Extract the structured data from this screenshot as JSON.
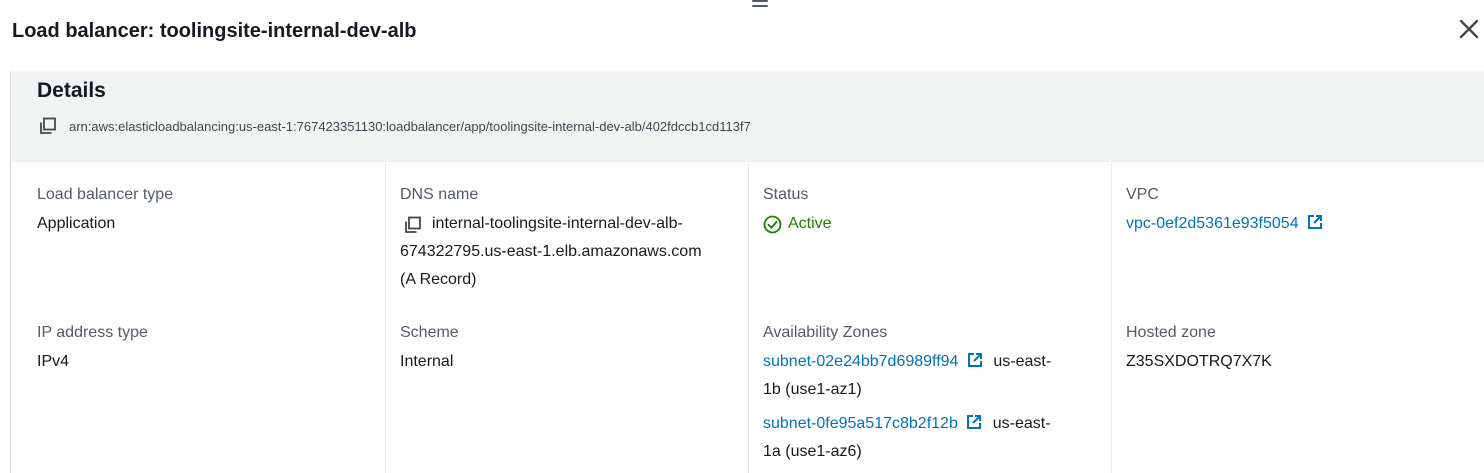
{
  "panel": {
    "title": "Load balancer: toolingsite-internal-dev-alb"
  },
  "details": {
    "title": "Details",
    "arn": "arn:aws:elasticloadbalancing:us-east-1:767423351130:loadbalancer/app/toolingsite-internal-dev-alb/402fdccb1cd113f7"
  },
  "fields": {
    "lb_type": {
      "label": "Load balancer type",
      "value": "Application"
    },
    "dns": {
      "label": "DNS name",
      "value_line1": "internal-toolingsite-internal-dev-alb-",
      "value_line2": "674322795.us-east-1.elb.amazonaws.com",
      "value_line3": "(A Record)"
    },
    "status": {
      "label": "Status",
      "value": "Active"
    },
    "vpc": {
      "label": "VPC",
      "value": "vpc-0ef2d5361e93f5054"
    },
    "ip_type": {
      "label": "IP address type",
      "value": "IPv4"
    },
    "scheme": {
      "label": "Scheme",
      "value": "Internal"
    },
    "azs": {
      "label": "Availability Zones",
      "subnets": [
        {
          "id": "subnet-02e24bb7d6989ff94",
          "zone_line1": "us-east-",
          "zone_line2": "1b (use1-az1)"
        },
        {
          "id": "subnet-0fe95a517c8b2f12b",
          "zone_line1": "us-east-",
          "zone_line2": "1a (use1-az6)"
        }
      ]
    },
    "hosted_zone": {
      "label": "Hosted zone",
      "value": "Z35SXDOTRQ7X7K"
    }
  },
  "colors": {
    "link": "#0073bb",
    "success": "#1d8102",
    "header_bg": "#f2f3f3"
  }
}
